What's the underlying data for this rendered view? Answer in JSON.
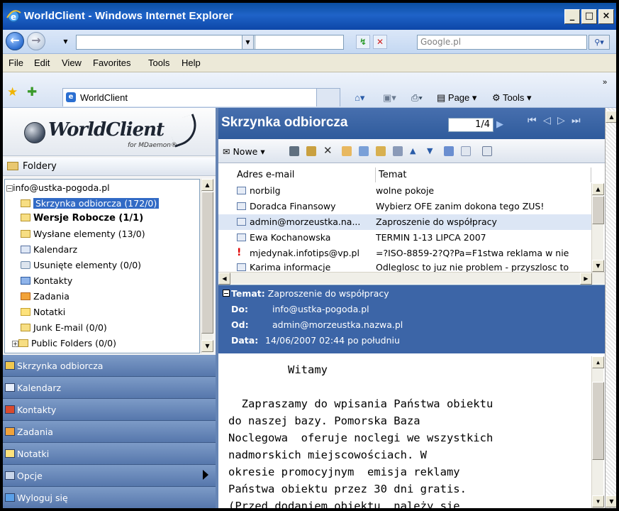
{
  "browser": {
    "title": "WorldClient - Windows Internet Explorer",
    "search_placeholder": "Google.pl",
    "menu": [
      "File",
      "Edit",
      "View",
      "Favorites",
      "Tools",
      "Help"
    ],
    "tab_title": "WorldClient",
    "cmd_page": "Page",
    "cmd_tools": "Tools"
  },
  "app": {
    "brand": "WorldClient",
    "brand_sub": "for MDaemon®",
    "folders_header": "Foldery",
    "account": "info@ustka-pogoda.pl",
    "folders": [
      {
        "label": "Skrzynka odbiorcza (172/0)",
        "icon": "inbox-icon",
        "selected": true
      },
      {
        "label": "Wersje Robocze (1/1)",
        "icon": "drafts-icon",
        "bold": true
      },
      {
        "label": "Wysłane elementy (13/0)",
        "icon": "sent-icon"
      },
      {
        "label": "Kalendarz",
        "icon": "calendar-icon"
      },
      {
        "label": "Usunięte elementy (0/0)",
        "icon": "trash-icon"
      },
      {
        "label": "Kontakty",
        "icon": "contacts-icon"
      },
      {
        "label": "Zadania",
        "icon": "tasks-icon"
      },
      {
        "label": "Notatki",
        "icon": "notes-icon"
      },
      {
        "label": "Junk E-mail (0/0)",
        "icon": "junk-icon"
      },
      {
        "label": "Public Folders (0/0)",
        "icon": "public-folders-icon"
      }
    ],
    "nav": [
      {
        "label": "Skrzynka odbiorcza",
        "icon": "inbox-icon"
      },
      {
        "label": "Kalendarz",
        "icon": "calendar-icon"
      },
      {
        "label": "Kontakty",
        "icon": "contacts-icon"
      },
      {
        "label": "Zadania",
        "icon": "tasks-icon"
      },
      {
        "label": "Notatki",
        "icon": "notes-icon"
      },
      {
        "label": "Opcje",
        "icon": "options-icon"
      },
      {
        "label": "Wyloguj się",
        "icon": "logout-icon"
      }
    ]
  },
  "mailbox": {
    "title": "Skrzynka odbiorcza",
    "page": "1/4",
    "new_label": "Nowe",
    "columns": [
      "Adres e-mail",
      "Temat"
    ],
    "messages": [
      {
        "from": "norbilg",
        "subject": "wolne pokoje"
      },
      {
        "from": "Doradca Finansowy",
        "subject": "Wybierz OFE zanim dokona tego ZUS!"
      },
      {
        "from": "admin@morzeustka.na...",
        "subject": "Zaproszenie do współpracy",
        "selected": true
      },
      {
        "from": "Ewa Kochanowska",
        "subject": "TERMIN 1-13 LIPCA 2007"
      },
      {
        "from": "mjedynak.infotips@vp.pl",
        "subject": "=?ISO-8859-2?Q?Pa=F1stwa reklama w nie",
        "important": true
      },
      {
        "from": "Karima informacje",
        "subject": "Odleglosc to juz nie problem - przyszlosc to"
      }
    ]
  },
  "preview": {
    "subject_label": "Temat:",
    "subject": "Zaproszenie do współpracy",
    "to_label": "Do:",
    "to": "info@ustka-pogoda.pl",
    "from_label": "Od:",
    "from": "admin@morzeustka.nazwa.pl",
    "date_label": "Data:",
    "date": "14/06/2007 02:44 po południu",
    "body_lines": [
      "         Witamy",
      "",
      "  Zapraszamy do wpisania Państwa obiektu",
      "do naszej bazy. Pomorska Baza",
      "Noclegowa  oferuje noclegi we wszystkich",
      "nadmorskich miejscowościach. W",
      "okresie promocyjnym  emisja reklamy",
      "Państwa obiektu przez 30 dni gratis.",
      "(Przed dodaniem obiektu  należy sie"
    ]
  }
}
